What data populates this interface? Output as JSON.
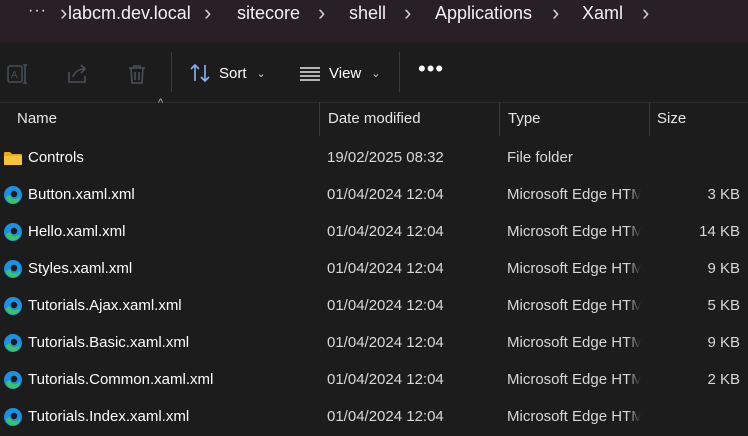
{
  "breadcrumb": {
    "more": "···",
    "items": [
      "labcm.dev.local",
      "sitecore",
      "shell",
      "Applications",
      "Xaml"
    ]
  },
  "toolbar": {
    "sort_label": "Sort",
    "view_label": "View",
    "icons": [
      "rename-icon",
      "share-icon",
      "delete-icon",
      "sort-icon",
      "view-icon",
      "more-icon"
    ]
  },
  "columns": {
    "name": "Name",
    "date": "Date modified",
    "type": "Type",
    "size": "Size"
  },
  "files": [
    {
      "name": "Controls",
      "date": "19/02/2025 08:32",
      "type": "File folder",
      "size": "",
      "icon": "folder-icon"
    },
    {
      "name": "Button.xaml.xml",
      "date": "01/04/2024 12:04",
      "type": "Microsoft Edge HTML Document",
      "size": "3 KB",
      "icon": "edge-icon"
    },
    {
      "name": "Hello.xaml.xml",
      "date": "01/04/2024 12:04",
      "type": "Microsoft Edge HTML Document",
      "size": "14 KB",
      "icon": "edge-icon"
    },
    {
      "name": "Styles.xaml.xml",
      "date": "01/04/2024 12:04",
      "type": "Microsoft Edge HTML Document",
      "size": "9 KB",
      "icon": "edge-icon"
    },
    {
      "name": "Tutorials.Ajax.xaml.xml",
      "date": "01/04/2024 12:04",
      "type": "Microsoft Edge HTML Document",
      "size": "5 KB",
      "icon": "edge-icon"
    },
    {
      "name": "Tutorials.Basic.xaml.xml",
      "date": "01/04/2024 12:04",
      "type": "Microsoft Edge HTML Document",
      "size": "9 KB",
      "icon": "edge-icon"
    },
    {
      "name": "Tutorials.Common.xaml.xml",
      "date": "01/04/2024 12:04",
      "type": "Microsoft Edge HTML Document",
      "size": "2 KB",
      "icon": "edge-icon"
    },
    {
      "name": "Tutorials.Index.xaml.xml",
      "date": "01/04/2024 12:04",
      "type": "Microsoft Edge HTML Document",
      "size": "",
      "icon": "edge-icon"
    }
  ],
  "colors": {
    "background": "#1c1c1c",
    "breadcrumb_bg": "#2a1f27",
    "folder": "#f5c242",
    "edge_blue": "#1f8fe0",
    "edge_green": "#3fc06b"
  }
}
